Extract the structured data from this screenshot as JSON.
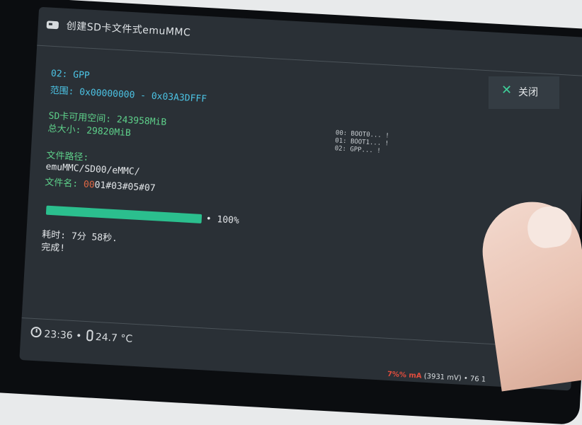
{
  "window": {
    "title": "创建SD卡文件式emuMMC"
  },
  "partition": {
    "name_label": "02: GPP",
    "range_label": "范围: 0x00000000 - 0x03A3DFFF"
  },
  "sd_card": {
    "free_space_label": "SD卡可用空间: 243958MiB",
    "total_size_label": "总大小: 29820MiB"
  },
  "file": {
    "path_title": "文件路径:",
    "path_value": "emuMMC/SD00/eMMC/",
    "name_prefix": "文件名: ",
    "name_highlight": "00",
    "name_rest": "01#03#05#07"
  },
  "progress": {
    "fraction": 1.0,
    "percent_label": "• 100%"
  },
  "result": {
    "elapsed_label": "耗时: 7分 58秒.",
    "done_label": "完成!"
  },
  "close_button": {
    "icon": "close-icon",
    "label": "关闭"
  },
  "log": {
    "lines": [
      "00: BOOT0... !",
      "01: BOOT1... !",
      "02: GPP... !"
    ]
  },
  "status": {
    "time": "23:36",
    "separator": "•",
    "temperature": "24.7 °C",
    "battery_low": "7%% mA",
    "battery_voltage": "(3931 mV)",
    "battery_tail": "• 76 1"
  },
  "colors": {
    "accent": "#2bbf8e",
    "cyan_text": "#4cc3e4",
    "green_text": "#5ed08a",
    "screen_bg": "#2a3036"
  }
}
